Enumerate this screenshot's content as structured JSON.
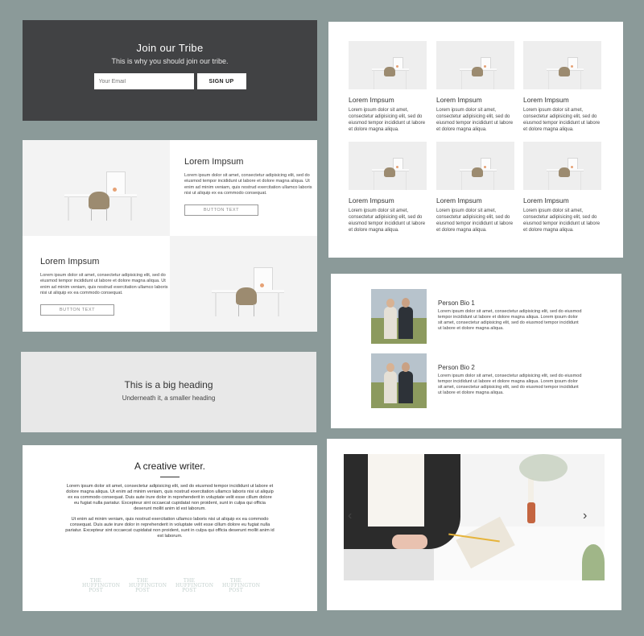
{
  "tribe": {
    "title": "Join our Tribe",
    "subtitle": "This is why you should join our tribe.",
    "email_placeholder": "Your Email",
    "signup_label": "SIGN UP"
  },
  "grid": {
    "items": [
      {
        "name": "Lorem Impsum",
        "desc": "Lorem ipsum dolor sit amet, consectetur adipisicing elit, sed do eiusmod tempor incididunt ut labore et dolore magna aliqua."
      },
      {
        "name": "Lorem Impsum",
        "desc": "Lorem ipsum dolor sit amet, consectetur adipisicing elit, sed do eiusmod tempor incididunt ut labore et dolore magna aliqua."
      },
      {
        "name": "Lorem Impsum",
        "desc": "Lorem ipsum dolor sit amet, consectetur adipisicing elit, sed do eiusmod tempor incididunt ut labore et dolore magna aliqua."
      },
      {
        "name": "Lorem Impsum",
        "desc": "Lorem ipsum dolor sit amet, consectetur adipisicing elit, sed do eiusmod tempor incididunt ut labore et dolore magna aliqua."
      },
      {
        "name": "Lorem Impsum",
        "desc": "Lorem ipsum dolor sit amet, consectetur adipisicing elit, sed do eiusmod tempor incididunt ut labore et dolore magna aliqua."
      },
      {
        "name": "Lorem Impsum",
        "desc": "Lorem ipsum dolor sit amet, consectetur adipisicing elit, sed do eiusmod tempor incididunt ut labore et dolore magna aliqua."
      }
    ]
  },
  "alternating": {
    "block1": {
      "title": "Lorem Impsum",
      "desc": "Lorem ipsum dolor sit amet, consectetur adipisicing elit, sed do eiusmod tempor incididunt ut labore et dolore magna aliqua. Ut enim ad minim veniam, quis nostrud exercitation ullamco laboris nisi ut aliquip ex ea commodo consequat.",
      "button": "BUTTON TEXT"
    },
    "block2": {
      "title": "Lorem Impsum",
      "desc": "Lorem ipsum dolor sit amet, consectetur adipisicing elit, sed do eiusmod tempor incididunt ut labore et dolore magna aliqua. Ut enim ad minim veniam, quis nostrud exercitation ullamco laboris nisi ut aliquip ex ea commodo consequat.",
      "button": "BUTTON TEXT"
    }
  },
  "people": {
    "p1": {
      "name": "Person Bio 1",
      "desc": "Lorem ipsum dolor sit amet, consectetur adipisicing elit, sed do eiusmod tempor incididunt ut labore et dolore magna aliqua. Lorem ipsum dolor sit amet, consectetur adipisicing elit, sed do eiusmod tempor incididunt ut labore et dolore magna aliqua."
    },
    "p2": {
      "name": "Person Bio 2",
      "desc": "Lorem ipsum dolor sit amet, consectetur adipisicing elit, sed do eiusmod tempor incididunt ut labore et dolore magna aliqua. Lorem ipsum dolor sit amet, consectetur adipisicing elit, sed do eiusmod tempor incididunt ut labore et dolore magna aliqua."
    }
  },
  "heading_block": {
    "title": "This is a big heading",
    "subtitle": "Underneath it, a smaller heading"
  },
  "writer": {
    "title": "A creative writer.",
    "para1": "Lorem ipsum dolor sit amet, consectetur adipisicing elit, sed do eiusmod tempor incididunt ut labore et dolore magna aliqua. Ut enim ad minim veniam, quis nostrud exercitation ullamco laboris nisi ut aliquip ex ea commodo consequat. Duis aute irure dolor in reprehenderit in voluptate velit esse cillum dolore eu fugiat nulla pariatur. Excepteur sint occaecat cupidatat non proident, sunt in culpa qui officia deserunt mollit anim id est laborum.",
    "para2": "Ut enim ad minim veniam, quis nostrud exercitation ullamco laboris nisi ut aliquip ex ea commodo consequat. Duis aute irure dolor in reprehenderit in voluptate velit esse cillum dolore eu fugiat nulla pariatur. Excepteur sint occaecat cupidatat non proident, sunt in culpa qui officia deserunt mollit anim id est laborum.",
    "press_logos": [
      "THE HUFFINGTON POST",
      "THE HUFFINGTON POST",
      "THE HUFFINGTON POST",
      "THE HUFFINGTON POST"
    ]
  },
  "slideshow": {
    "prev_icon": "chevron-left-icon",
    "next_icon": "chevron-right-icon"
  },
  "colors": {
    "background": "#8b9a99",
    "dark_banner": "#414244",
    "heading_bg": "#e8e8e8",
    "logo_tint": "#c2cfcc"
  }
}
